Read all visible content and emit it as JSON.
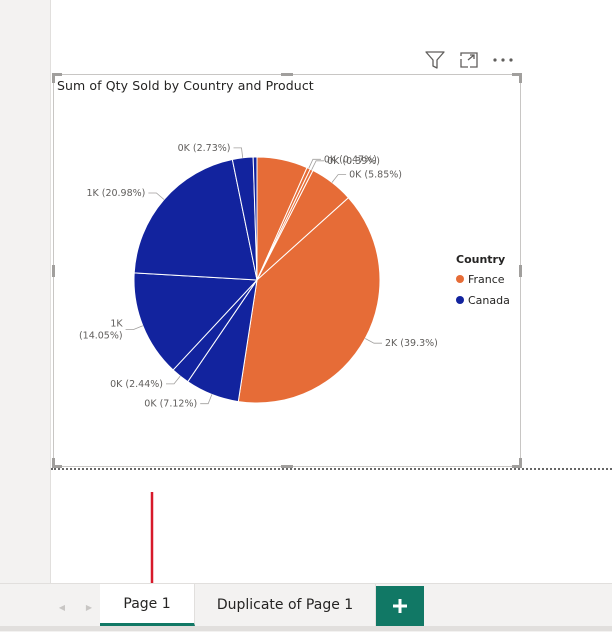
{
  "visual": {
    "title": "Sum of Qty Sold by Country and Product"
  },
  "header_icons": [
    "filter-icon",
    "focus-mode-icon",
    "more-options-icon"
  ],
  "colors": {
    "france": "#E66C37",
    "canada": "#12239E",
    "tab_accent": "#117865",
    "arrow": "#D7192A"
  },
  "chart_data": {
    "type": "pie",
    "title": "Sum of Qty Sold by Country and Product",
    "legend": {
      "title": "Country",
      "position": "right",
      "entries": [
        "France",
        "Canada"
      ]
    },
    "slices": [
      {
        "country": "France",
        "percent": 6.7,
        "label": ""
      },
      {
        "country": "France",
        "percent": 0.47,
        "label": "0K (0.47%)"
      },
      {
        "country": "France",
        "percent": 0.39,
        "label": "0K (0.39%)"
      },
      {
        "country": "France",
        "percent": 5.85,
        "label": "0K (5.85%)"
      },
      {
        "country": "France",
        "percent": 39.3,
        "label": "2K (39.3%)"
      },
      {
        "country": "Canada",
        "percent": 7.12,
        "label": "0K (7.12%)"
      },
      {
        "country": "Canada",
        "percent": 2.44,
        "label": "0K (2.44%)"
      },
      {
        "country": "Canada",
        "percent": 14.05,
        "label": "1K\n(14.05%)"
      },
      {
        "country": "Canada",
        "percent": 20.98,
        "label": "1K (20.98%)"
      },
      {
        "country": "Canada",
        "percent": 2.73,
        "label": "0K (2.73%)"
      },
      {
        "country": "Canada",
        "percent": 0.5,
        "label": ""
      }
    ]
  },
  "tabs": {
    "items": [
      {
        "label": "Page 1",
        "active": true
      },
      {
        "label": "Duplicate of Page 1",
        "active": false
      }
    ],
    "prev_glyph": "◀",
    "next_glyph": "▶",
    "add_glyph": "+"
  }
}
